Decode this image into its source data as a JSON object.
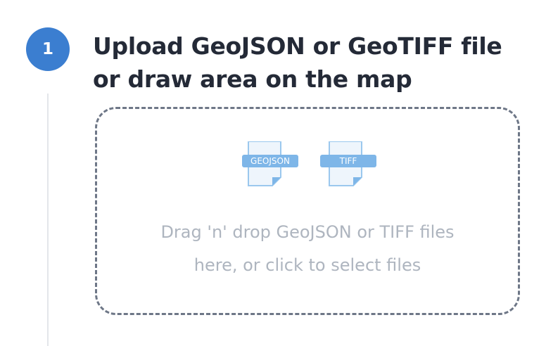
{
  "step": {
    "number": "1",
    "title_line1": "Upload GeoJSON or GeoTIFF file",
    "title_line2": "or draw area on the map"
  },
  "dropzone": {
    "file_types": [
      "GEOJSON",
      "TIFF"
    ],
    "text_line1": "Drag 'n' drop GeoJSON or TIFF files",
    "text_line2": "here, or click to select files"
  },
  "colors": {
    "step_circle": "#3b7ed0",
    "title": "#242a37",
    "dropzone_border": "#6e7787",
    "file_icon_badge": "#7eb6e8",
    "file_icon_body": "#eef5fc",
    "drop_text": "#aeb5bf",
    "timeline_line": "#e3e6ea"
  },
  "icons": [
    "geojson-file-icon",
    "tiff-file-icon"
  ]
}
